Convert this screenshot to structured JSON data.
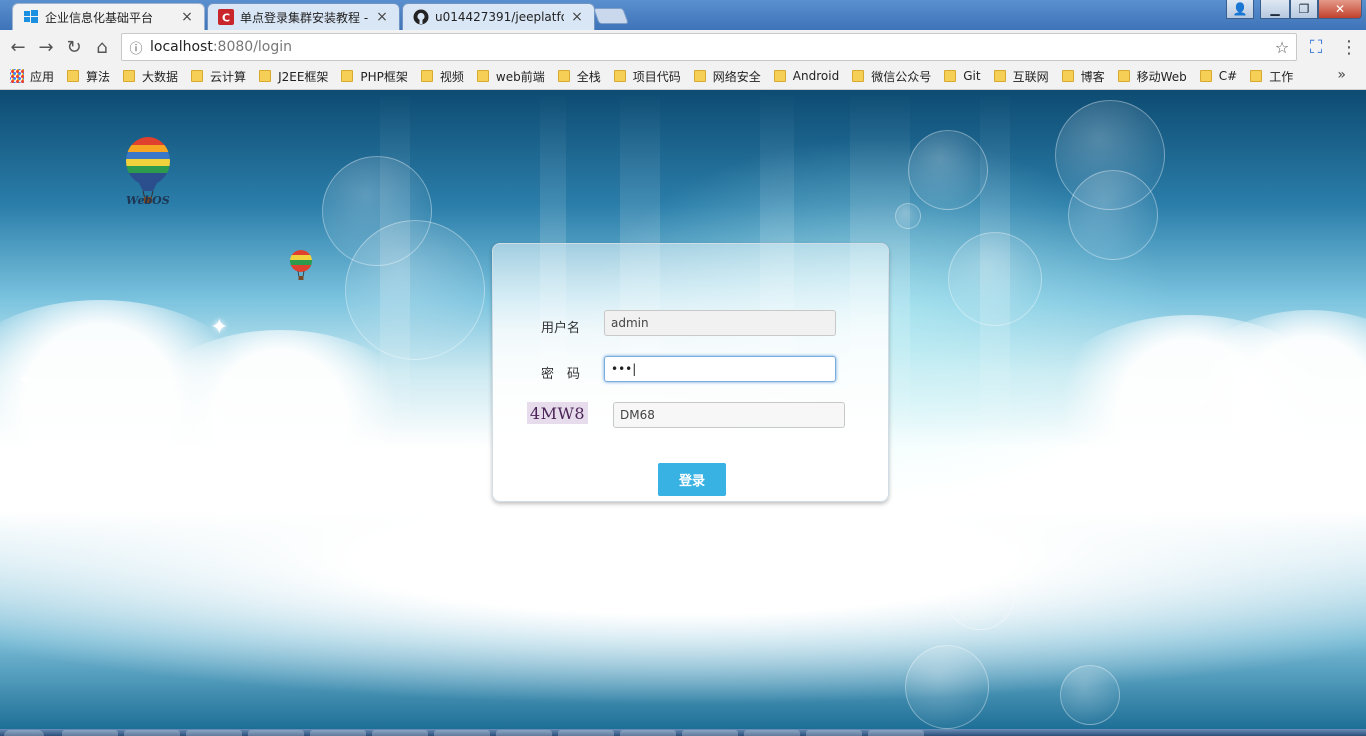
{
  "browser": {
    "tabs": [
      {
        "title": "企业信息化基础平台",
        "active": true,
        "icon": "windows-logo-icon"
      },
      {
        "title": "单点登录集群安装教程 -",
        "active": false,
        "icon": "csdn-logo-icon"
      },
      {
        "title": "u014427391/jeeplatfor",
        "active": false,
        "icon": "github-logo-icon"
      }
    ],
    "tab_close_glyph": "×",
    "window_controls": {
      "user": "👤",
      "minimize": "▁",
      "maximize": "❐",
      "close": "✕"
    },
    "nav": {
      "back": "←",
      "forward": "→",
      "reload": "↻",
      "home": "⌂"
    },
    "url_host": "localhost",
    "url_rest": ":8080/login",
    "info_glyph": "ⓘ",
    "star_glyph": "☆",
    "cast_glyph": "⛶",
    "menu_glyph": "⋮"
  },
  "bookmarks": {
    "apps_label": "应用",
    "folders": [
      "算法",
      "大数据",
      "云计算",
      "J2EE框架",
      "PHP框架",
      "视频",
      "web前端",
      "全栈",
      "项目代码",
      "网络安全",
      "Android",
      "微信公众号",
      "Git",
      "互联网",
      "博客",
      "移动Web",
      "C#",
      "工作"
    ],
    "more": "»"
  },
  "page": {
    "logo_text": "WebOS",
    "login": {
      "username_label": "用户名",
      "username_value": "admin",
      "password_label": "密　码",
      "password_value": "•••|",
      "captcha_image_text": "4MW8",
      "captcha_value": "DM68",
      "submit_label": "登录"
    }
  },
  "colors": {
    "login_button": "#38b2e3",
    "focus_border": "#7aaee0",
    "captcha_bg": "#e6dcec"
  }
}
